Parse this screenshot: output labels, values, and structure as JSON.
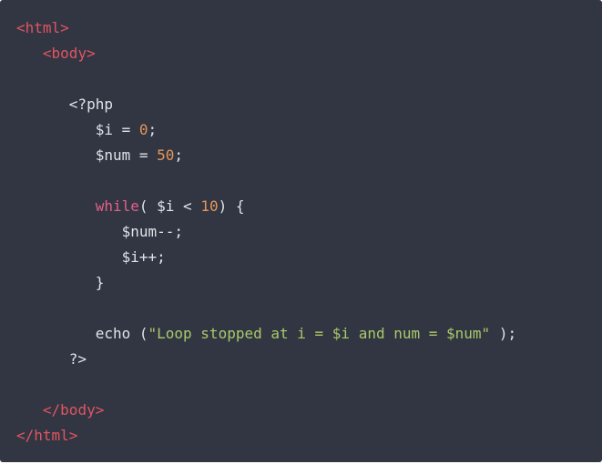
{
  "colors": {
    "background": "#323642",
    "tag": "#e05561",
    "plain": "#dfe3ea",
    "number": "#e5955b",
    "keyword": "#e55f8a",
    "string": "#a9c96a"
  },
  "lines": [
    [
      {
        "t": "tag",
        "v": "<html>"
      }
    ],
    [
      {
        "t": "plain",
        "v": "   "
      },
      {
        "t": "tag",
        "v": "<body>"
      }
    ],
    [],
    [
      {
        "t": "plain",
        "v": "      <?php"
      }
    ],
    [
      {
        "t": "plain",
        "v": "         $i = "
      },
      {
        "t": "num",
        "v": "0"
      },
      {
        "t": "plain",
        "v": ";"
      }
    ],
    [
      {
        "t": "plain",
        "v": "         $num = "
      },
      {
        "t": "num",
        "v": "50"
      },
      {
        "t": "plain",
        "v": ";"
      }
    ],
    [],
    [
      {
        "t": "plain",
        "v": "         "
      },
      {
        "t": "kw",
        "v": "while"
      },
      {
        "t": "plain",
        "v": "( $i < "
      },
      {
        "t": "num",
        "v": "10"
      },
      {
        "t": "plain",
        "v": ") {"
      }
    ],
    [
      {
        "t": "plain",
        "v": "            $num--;"
      }
    ],
    [
      {
        "t": "plain",
        "v": "            $i++;"
      }
    ],
    [
      {
        "t": "plain",
        "v": "         }"
      }
    ],
    [],
    [
      {
        "t": "plain",
        "v": "         echo ("
      },
      {
        "t": "str",
        "v": "\"Loop stopped at i = $i and num = $num\""
      },
      {
        "t": "plain",
        "v": " );"
      }
    ],
    [
      {
        "t": "plain",
        "v": "      ?>"
      }
    ],
    [],
    [
      {
        "t": "plain",
        "v": "   "
      },
      {
        "t": "tag",
        "v": "</body>"
      }
    ],
    [
      {
        "t": "tag",
        "v": "</html>"
      }
    ]
  ]
}
